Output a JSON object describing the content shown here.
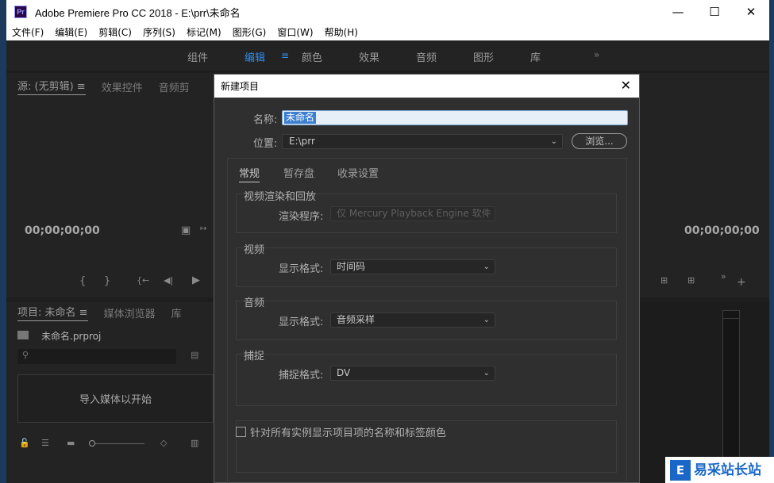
{
  "window": {
    "app_icon_text": "Pr",
    "title": "Adobe Premiere Pro CC 2018 - E:\\prr\\未命名",
    "minimize": "—",
    "maximize": "☐",
    "close": "✕"
  },
  "menubar": [
    "文件(F)",
    "编辑(E)",
    "剪辑(C)",
    "序列(S)",
    "标记(M)",
    "图形(G)",
    "窗口(W)",
    "帮助(H)"
  ],
  "workspaces": {
    "tabs": [
      "组件",
      "编辑",
      "颜色",
      "效果",
      "音频",
      "图形",
      "库"
    ],
    "active": "编辑",
    "menu_icon": "≡",
    "more": "»"
  },
  "source_panel": {
    "tabs": [
      "源: (无剪辑)",
      "效果控件",
      "音频剪"
    ],
    "timecode": "00;00;00;00",
    "menu_icon": "≡"
  },
  "program_panel": {
    "timecode": "00;00;00;00"
  },
  "project_panel": {
    "tabs": [
      "项目: 未命名",
      "媒体浏览器",
      "库"
    ],
    "menu_icon": "≡",
    "file_name": "未命名.prproj",
    "import_hint": "导入媒体以开始"
  },
  "dialog": {
    "title": "新建项目",
    "close": "✕",
    "name_label": "名称:",
    "name_value": "未命名",
    "location_label": "位置:",
    "location_value": "E:\\prr",
    "browse_button": "浏览...",
    "tabs": [
      "常规",
      "暂存盘",
      "收录设置"
    ],
    "active_tab": "常规",
    "groups": {
      "render": {
        "title": "视频渲染和回放",
        "renderer_label": "渲染程序:",
        "renderer_value": "仅 Mercury Playback Engine 软件"
      },
      "video": {
        "title": "视频",
        "format_label": "显示格式:",
        "format_value": "时间码"
      },
      "audio": {
        "title": "音频",
        "format_label": "显示格式:",
        "format_value": "音频采样"
      },
      "capture": {
        "title": "捕捉",
        "format_label": "捕捉格式:",
        "format_value": "DV"
      }
    },
    "checkbox_label": "针对所有实例显示项目项的名称和标签颜色"
  },
  "watermark": {
    "logo": "E",
    "text": "易采站长站"
  },
  "colors": {
    "accent": "#2d8ceb",
    "panel_bg": "#232323",
    "dialog_bg": "#2f2f2f",
    "selection": "#3c7fd1"
  }
}
